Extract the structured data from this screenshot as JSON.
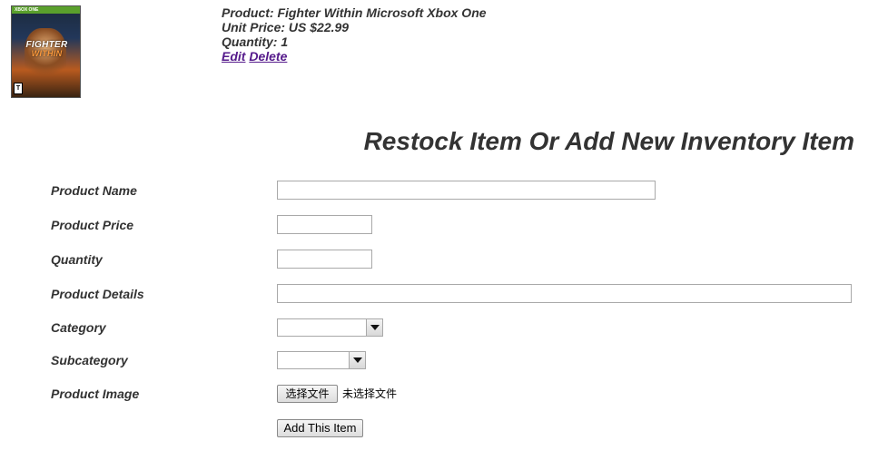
{
  "product": {
    "image_text": {
      "brand_bar": "XBOX ONE",
      "title_line1": "FIGHTER",
      "title_line2": "WITHIN",
      "rating": "T"
    },
    "name_line": "Product:  Fighter Within Microsoft Xbox One",
    "price_line": "Unit Price: US $22.99",
    "quantity_line": "Quantity:  1",
    "edit_label": "Edit",
    "delete_label": "Delete"
  },
  "form": {
    "heading": "Restock Item Or Add New Inventory Item",
    "fields": {
      "product_name": {
        "label": "Product Name",
        "value": ""
      },
      "product_price": {
        "label": "Product Price",
        "value": ""
      },
      "quantity": {
        "label": "Quantity",
        "value": ""
      },
      "product_details": {
        "label": "Product Details",
        "value": ""
      },
      "category": {
        "label": "Category",
        "selected": ""
      },
      "subcategory": {
        "label": "Subcategory",
        "selected": ""
      },
      "product_image": {
        "label": "Product Image",
        "button_label": "选择文件",
        "status_text": "未选择文件"
      }
    },
    "submit_label": "Add This Item"
  },
  "colors": {
    "text": "#333333",
    "link": "#551a8b",
    "input_border": "#a9a9a9"
  }
}
